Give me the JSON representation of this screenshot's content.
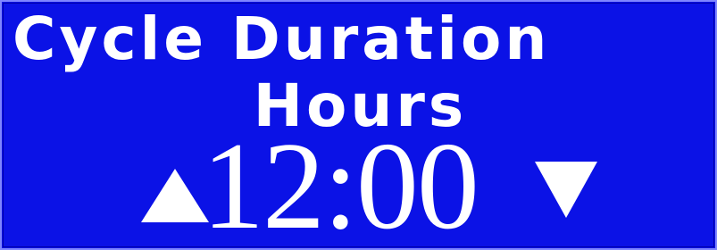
{
  "screen": {
    "title": "Cycle Duration",
    "subtitle": "Hours",
    "value": "12:00"
  },
  "icons": {
    "increase": "arrow-up-icon",
    "decrease": "arrow-down-icon"
  },
  "colors": {
    "background": "#0b12e6",
    "text": "#ffffff",
    "border": "#7f86ff"
  }
}
